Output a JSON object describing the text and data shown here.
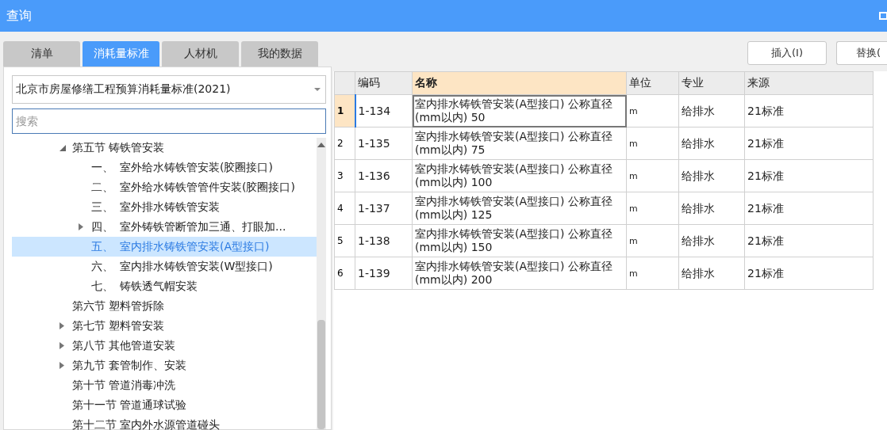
{
  "window": {
    "title": "查询"
  },
  "tabs": [
    {
      "label": "清单",
      "selected": false
    },
    {
      "label": "消耗量标准",
      "selected": true
    },
    {
      "label": "人材机",
      "selected": false
    },
    {
      "label": "我的数据",
      "selected": false
    }
  ],
  "library_select": {
    "value": "北京市房屋修缮工程预算消耗量标准(2021)"
  },
  "search": {
    "placeholder": "搜索"
  },
  "tree": [
    {
      "label": "第五节 铸铁管安装",
      "expanded": true,
      "selected": false,
      "children": [
        {
          "num": "一、",
          "label": "室外给水铸铁管安装(胶圈接口)",
          "selected": false
        },
        {
          "num": "二、",
          "label": "室外给水铸铁管管件安装(胶圈接口)",
          "selected": false
        },
        {
          "num": "三、",
          "label": "室外排水铸铁管安装",
          "selected": false
        },
        {
          "num": "四、",
          "label": "室外铸铁管断管加三通、打眼加...",
          "expanded": false,
          "selected": false
        },
        {
          "num": "五、",
          "label": "室内排水铸铁管安装(A型接口)",
          "selected": true
        },
        {
          "num": "六、",
          "label": "室内排水铸铁管安装(W型接口)",
          "selected": false
        },
        {
          "num": "七、",
          "label": "铸铁透气帽安装",
          "selected": false
        }
      ]
    },
    {
      "label": "第六节 塑料管拆除",
      "selected": false
    },
    {
      "label": "第七节 塑料管安装",
      "expanded": false,
      "selected": false
    },
    {
      "label": "第八节 其他管道安装",
      "expanded": false,
      "selected": false
    },
    {
      "label": "第九节 套管制作、安装",
      "expanded": false,
      "selected": false
    },
    {
      "label": "第十节 管道消毒冲洗",
      "selected": false
    },
    {
      "label": "第十一节 管道通球试验",
      "selected": false
    },
    {
      "label": "第十二节 室内外水源管道碰头",
      "selected": false
    }
  ],
  "buttons": [
    "插入(I)",
    "替换("
  ],
  "table": {
    "columns": [
      {
        "label": "编码",
        "selected": false
      },
      {
        "label": "名称",
        "selected": true
      },
      {
        "label": "单位",
        "selected": false
      },
      {
        "label": "专业",
        "selected": false
      },
      {
        "label": "来源",
        "selected": false
      }
    ],
    "rows": [
      {
        "index": "1",
        "selected": true,
        "cells": [
          "1-134",
          "室内排水铸铁管安装(A型接口) 公称直径(mm以内) 50",
          "m",
          "给排水",
          "21标准"
        ]
      },
      {
        "index": "2",
        "selected": false,
        "cells": [
          "1-135",
          "室内排水铸铁管安装(A型接口) 公称直径(mm以内) 75",
          "m",
          "给排水",
          "21标准"
        ]
      },
      {
        "index": "3",
        "selected": false,
        "cells": [
          "1-136",
          "室内排水铸铁管安装(A型接口) 公称直径(mm以内) 100",
          "m",
          "给排水",
          "21标准"
        ]
      },
      {
        "index": "4",
        "selected": false,
        "cells": [
          "1-137",
          "室内排水铸铁管安装(A型接口) 公称直径(mm以内) 125",
          "m",
          "给排水",
          "21标准"
        ]
      },
      {
        "index": "5",
        "selected": false,
        "cells": [
          "1-138",
          "室内排水铸铁管安装(A型接口) 公称直径(mm以内) 150",
          "m",
          "给排水",
          "21标准"
        ]
      },
      {
        "index": "6",
        "selected": false,
        "cells": [
          "1-139",
          "室内排水铸铁管安装(A型接口) 公称直径(mm以内) 200",
          "m",
          "给排水",
          "21标准"
        ]
      }
    ]
  }
}
